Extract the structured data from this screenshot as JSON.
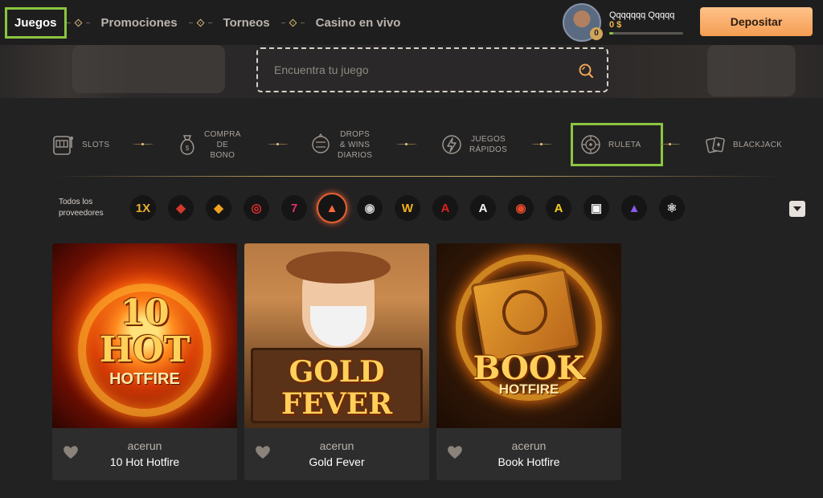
{
  "header": {
    "nav": [
      {
        "label": "Juegos",
        "active": true
      },
      {
        "label": "Promociones"
      },
      {
        "label": "Torneos"
      },
      {
        "label": "Casino en vivo"
      }
    ],
    "user": {
      "name": "Qqqqqqq Qqqqq",
      "balance": "0 $",
      "level": "0",
      "xp_progress": 0.05
    },
    "deposit_label": "Depositar"
  },
  "search": {
    "placeholder": "Encuentra tu juego",
    "icon": "search-icon"
  },
  "categories": [
    {
      "label": "SLOTS",
      "icon": "slot-machine-icon"
    },
    {
      "label": "COMPRA\nDE\nBONO",
      "icon": "money-bag-icon"
    },
    {
      "label": "DROPS\n& WINS\nDIARIOS",
      "icon": "drops-wins-icon"
    },
    {
      "label": "JUEGOS\nRÁPIDOS",
      "icon": "lightning-icon"
    },
    {
      "label": "RULETA",
      "icon": "roulette-icon",
      "selected": true
    },
    {
      "label": "BLACKJACK",
      "icon": "cards-icon"
    }
  ],
  "providers": {
    "label": "Todos los\nproveedores",
    "items": [
      {
        "name": "provider-1-logo",
        "glyph": "1X"
      },
      {
        "name": "provider-2-logo",
        "glyph": "◆"
      },
      {
        "name": "provider-3-logo",
        "glyph": "◆"
      },
      {
        "name": "provider-4-logo",
        "glyph": "◎"
      },
      {
        "name": "provider-5-logo",
        "glyph": "7"
      },
      {
        "name": "provider-6-logo",
        "glyph": "▲",
        "active": true
      },
      {
        "name": "provider-7-logo",
        "glyph": "◉"
      },
      {
        "name": "provider-8-logo",
        "glyph": "W"
      },
      {
        "name": "provider-9-logo",
        "glyph": "A"
      },
      {
        "name": "provider-10-logo",
        "glyph": "A"
      },
      {
        "name": "provider-11-logo",
        "glyph": "◉"
      },
      {
        "name": "provider-12-logo",
        "glyph": "A"
      },
      {
        "name": "provider-13-logo",
        "glyph": "▣"
      },
      {
        "name": "provider-14-logo",
        "glyph": "▲"
      },
      {
        "name": "provider-15-logo",
        "glyph": "⚛"
      }
    ]
  },
  "games": [
    {
      "provider": "acerun",
      "title": "10 Hot Hotfire",
      "art_main": "10\nHOT",
      "art_sub": "HOTFIRE"
    },
    {
      "provider": "acerun",
      "title": "Gold Fever",
      "art_main": "GOLD\nFEVER",
      "art_sub": ""
    },
    {
      "provider": "acerun",
      "title": "Book Hotfire",
      "art_main": "BOOK",
      "art_sub": "HOTFIRE"
    }
  ],
  "colors": {
    "accent_green": "#8bc541",
    "deposit": "#f49d52",
    "gold": "#f0b94d",
    "bg": "#232222"
  }
}
